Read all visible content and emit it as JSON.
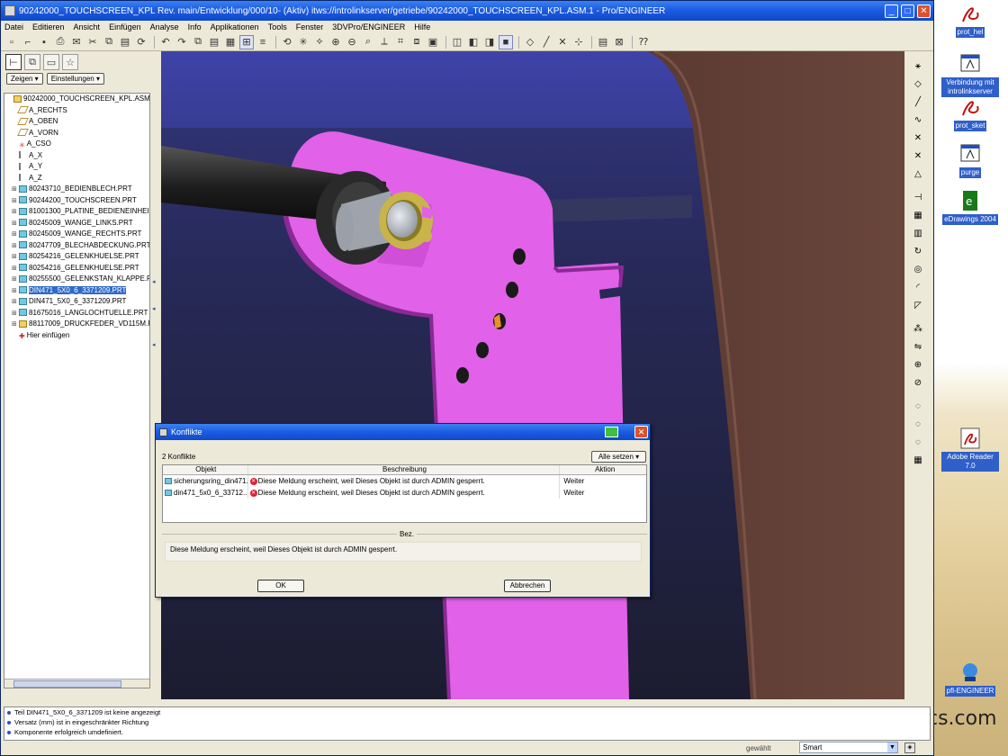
{
  "window": {
    "title": "90242000_TOUCHSCREEN_KPL Rev. main/Entwicklung/000/10- (Aktiv) itws://introlinkserver/getriebe/90242000_TOUCHSCREEN_KPL.ASM.1 - Pro/ENGINEER",
    "min": "_",
    "max": "□",
    "close": "✕"
  },
  "menu": [
    "Datei",
    "Editieren",
    "Ansicht",
    "Einfügen",
    "Analyse",
    "Info",
    "Applikationen",
    "Tools",
    "Fenster",
    "3DVPro/ENGINEER",
    "Hilfe"
  ],
  "left_panel": {
    "show_button": "Zeigen ▾",
    "settings_button": "Einstellungen ▾"
  },
  "tree": [
    {
      "label": "90242000_TOUCHSCREEN_KPL.ASM",
      "icon": "asm",
      "exp": ""
    },
    {
      "label": "A_RECHTS",
      "icon": "plane",
      "exp": ""
    },
    {
      "label": "A_OBEN",
      "icon": "plane",
      "exp": ""
    },
    {
      "label": "A_VORN",
      "icon": "plane",
      "exp": ""
    },
    {
      "label": "A_CSO",
      "icon": "csys",
      "exp": ""
    },
    {
      "label": "A_X",
      "icon": "axis",
      "exp": ""
    },
    {
      "label": "A_Y",
      "icon": "axis",
      "exp": ""
    },
    {
      "label": "A_Z",
      "icon": "axis",
      "exp": ""
    },
    {
      "label": "80243710_BEDIENBLECH.PRT",
      "icon": "prt",
      "exp": "+"
    },
    {
      "label": "90244200_TOUCHSCREEN.PRT",
      "icon": "prt",
      "exp": "+"
    },
    {
      "label": "81001300_PLATINE_BEDIENEINHEIT",
      "icon": "prt",
      "exp": "+"
    },
    {
      "label": "80245009_WANGE_LINKS.PRT",
      "icon": "prt",
      "exp": "+"
    },
    {
      "label": "80245009_WANGE_RECHTS.PRT",
      "icon": "prt",
      "exp": "+"
    },
    {
      "label": "80247709_BLECHABDECKUNG.PRT",
      "icon": "prt",
      "exp": "+"
    },
    {
      "label": "80254216_GELENKHUELSE.PRT",
      "icon": "prt",
      "exp": "+"
    },
    {
      "label": "80254216_GELENKHUELSE.PRT",
      "icon": "prt",
      "exp": "+"
    },
    {
      "label": "80255500_GELENKSTAN_KLAPPE.P",
      "icon": "prt",
      "exp": "+"
    },
    {
      "label": "DIN471_5X0_6_3371209.PRT",
      "icon": "prt",
      "exp": "+",
      "selected": true
    },
    {
      "label": "DIN471_5X0_6_3371209.PRT",
      "icon": "prt",
      "exp": "+"
    },
    {
      "label": "81675016_LANGLOCHTUELLE.PRT",
      "icon": "prt",
      "exp": "+"
    },
    {
      "label": "88117009_DRUCKFEDER_VD115M.P",
      "icon": "asm",
      "exp": "+"
    },
    {
      "label": "Hier einfügen",
      "icon": "ins",
      "exp": ""
    }
  ],
  "dialog": {
    "title": "Konflikte",
    "count": "2 Konflikte",
    "all_select": "Alle setzen ▾",
    "col_object": "Objekt",
    "col_description": "Beschreibung",
    "col_action": "Aktion",
    "rows": [
      {
        "object": "sicherungsring_din471...",
        "description": "Diese Meldung erscheint, weil Dieses Objekt ist durch ADMIN gesperrt.",
        "action": "Weiter"
      },
      {
        "object": "din471_5x0_6_33712...",
        "description": "Diese Meldung erscheint, weil Dieses Objekt ist durch ADMIN gesperrt.",
        "action": "Weiter"
      }
    ],
    "desc_label": "Bez.",
    "message": "Diese Meldung erscheint, weil Dieses Objekt ist durch ADMIN gesperrt.",
    "ok": "OK",
    "cancel": "Abbrechen"
  },
  "messages": [
    "Teil DIN471_5X0_6_3371209 ist keine angezeigt",
    "Versatz (mm) ist in eingeschränkter Richtung",
    "Komponente erfolgreich umdefiniert."
  ],
  "status": {
    "label": "gewählt",
    "filter_value": "Smart"
  },
  "desktop_icons": [
    {
      "label": "prot_hel"
    },
    {
      "label": "Verbindung mit introlinkserver"
    },
    {
      "label": "prot_sket"
    },
    {
      "label": "purge"
    },
    {
      "label": "eDrawings 2004"
    },
    {
      "label": "Adobe Reader 7.0"
    },
    {
      "label": "pfl-ENGINEER"
    }
  ],
  "watermark": "cs.com",
  "colors": {
    "titlebar": "#1c5ce2",
    "part_magenta": "#e161e8",
    "bg_top": "#3a3f9e",
    "brown": "#5a3a32"
  }
}
